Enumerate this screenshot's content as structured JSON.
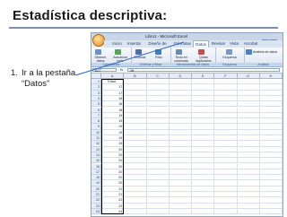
{
  "slide": {
    "title": "Estadística descriptiva:",
    "bullet_number": "1.",
    "bullet_text": "Ir a la pestaña “Datos”"
  },
  "excel": {
    "window_title": "Libro1 - Microsoft Excel",
    "tabs": [
      "Inicio",
      "Insertar",
      "Diseño de página",
      "Fórmulas",
      "Datos",
      "Revisar",
      "Vista",
      "Acrobat"
    ],
    "active_tab": "Datos",
    "ribbon": {
      "groups": [
        {
          "label": "Conexiones",
          "buttons": [
            "Obtener datos externos",
            "Actualizar todo"
          ]
        },
        {
          "label": "Ordenar y filtrar",
          "buttons": [
            "Ordenar",
            "Filtro"
          ]
        },
        {
          "label": "Herramientas de datos",
          "buttons": [
            "Texto en columnas",
            "Quitar duplicados"
          ]
        },
        {
          "label": "Esquema",
          "buttons": [
            "Esquema"
          ]
        },
        {
          "label": "Análisis",
          "buttons": [
            "Análisis de datos"
          ]
        }
      ]
    },
    "formula_bar": {
      "name_box": "A27",
      "fx": "fx",
      "value": "26"
    },
    "columns": [
      "A",
      "B",
      "C",
      "D",
      "E",
      "F",
      "G",
      "H"
    ],
    "rows": [
      {
        "n": "1",
        "a": "Edad"
      },
      {
        "n": "2",
        "a": "17"
      },
      {
        "n": "3",
        "a": "17"
      },
      {
        "n": "4",
        "a": "18"
      },
      {
        "n": "5",
        "a": "18"
      },
      {
        "n": "6",
        "a": "18"
      },
      {
        "n": "7",
        "a": "19"
      },
      {
        "n": "8",
        "a": "19"
      },
      {
        "n": "9",
        "a": "19"
      },
      {
        "n": "10",
        "a": "19"
      },
      {
        "n": "11",
        "a": "19"
      },
      {
        "n": "12",
        "a": "19"
      },
      {
        "n": "13",
        "a": "20"
      },
      {
        "n": "14",
        "a": "20"
      },
      {
        "n": "15",
        "a": "20"
      },
      {
        "n": "16",
        "a": "20"
      },
      {
        "n": "17",
        "a": "20"
      },
      {
        "n": "18",
        "a": "20"
      },
      {
        "n": "19",
        "a": "20"
      },
      {
        "n": "20",
        "a": "21"
      },
      {
        "n": "21",
        "a": "21"
      },
      {
        "n": "22",
        "a": "22"
      },
      {
        "n": "23",
        "a": "23"
      },
      {
        "n": "24",
        "a": "24"
      }
    ]
  },
  "colors": {
    "accent_line": "#7f8fa6",
    "callout_line": "#2d6ac4",
    "ribbon_bg": "#dde7f3"
  }
}
